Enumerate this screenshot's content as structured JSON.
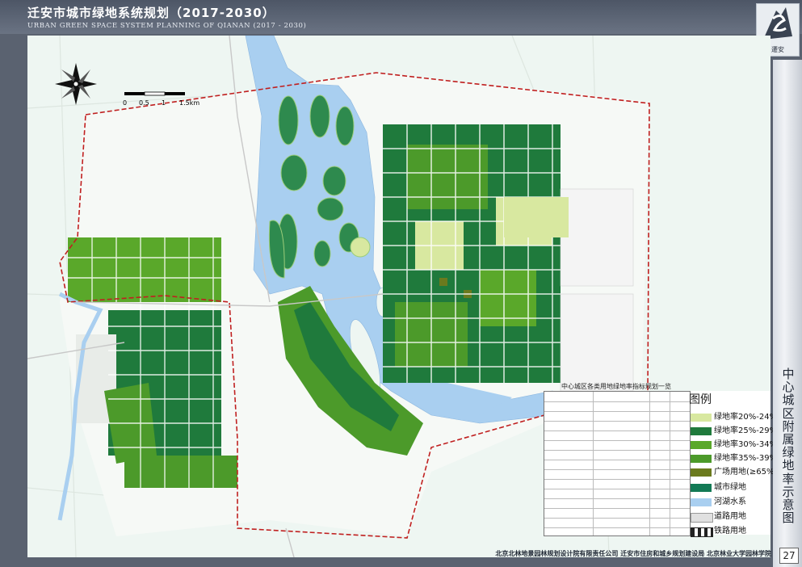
{
  "header": {
    "title_cn": "迁安市城市绿地系统规划（2017-2030）",
    "title_en": "URBAN GREEN SPACE SYSTEM PLANNING OF QIANAN (2017 - 2030)"
  },
  "logo": {
    "text": "遷安",
    "icon": "city-logo-icon"
  },
  "sidebar": {
    "map_title": "中心城区附属绿地率示意图",
    "page_number": "27"
  },
  "scale_bar": {
    "labels": [
      "0",
      "0.5",
      "1",
      "1.5km"
    ]
  },
  "compass": {
    "icon": "north-arrow-compass-icon"
  },
  "table": {
    "caption": "中心城区各类用地绿地率指标规划一览"
  },
  "legend": {
    "title": "图例",
    "items": [
      {
        "label": "绿地率20%-24%",
        "color": "#d8e8a0"
      },
      {
        "label": "绿地率25%-29%",
        "color": "#1f7a3c"
      },
      {
        "label": "绿地率30%-34%",
        "color": "#5aa82a"
      },
      {
        "label": "绿地率35%-39%",
        "color": "#4c9a2a"
      },
      {
        "label": "广场用地(≥65%)",
        "color": "#6b7a1e"
      },
      {
        "label": "城市绿地",
        "color": "#127a55"
      },
      {
        "label": "河湖水系",
        "color": "#a9cff0"
      },
      {
        "label": "道路用地",
        "color": "#e0e0e0"
      },
      {
        "label": "铁路用地",
        "color": "#777777"
      }
    ]
  },
  "credits": "北京北林地景园林规划设计院有限责任公司  迁安市住房和城乡规划建设局  北京林业大学园林学院"
}
